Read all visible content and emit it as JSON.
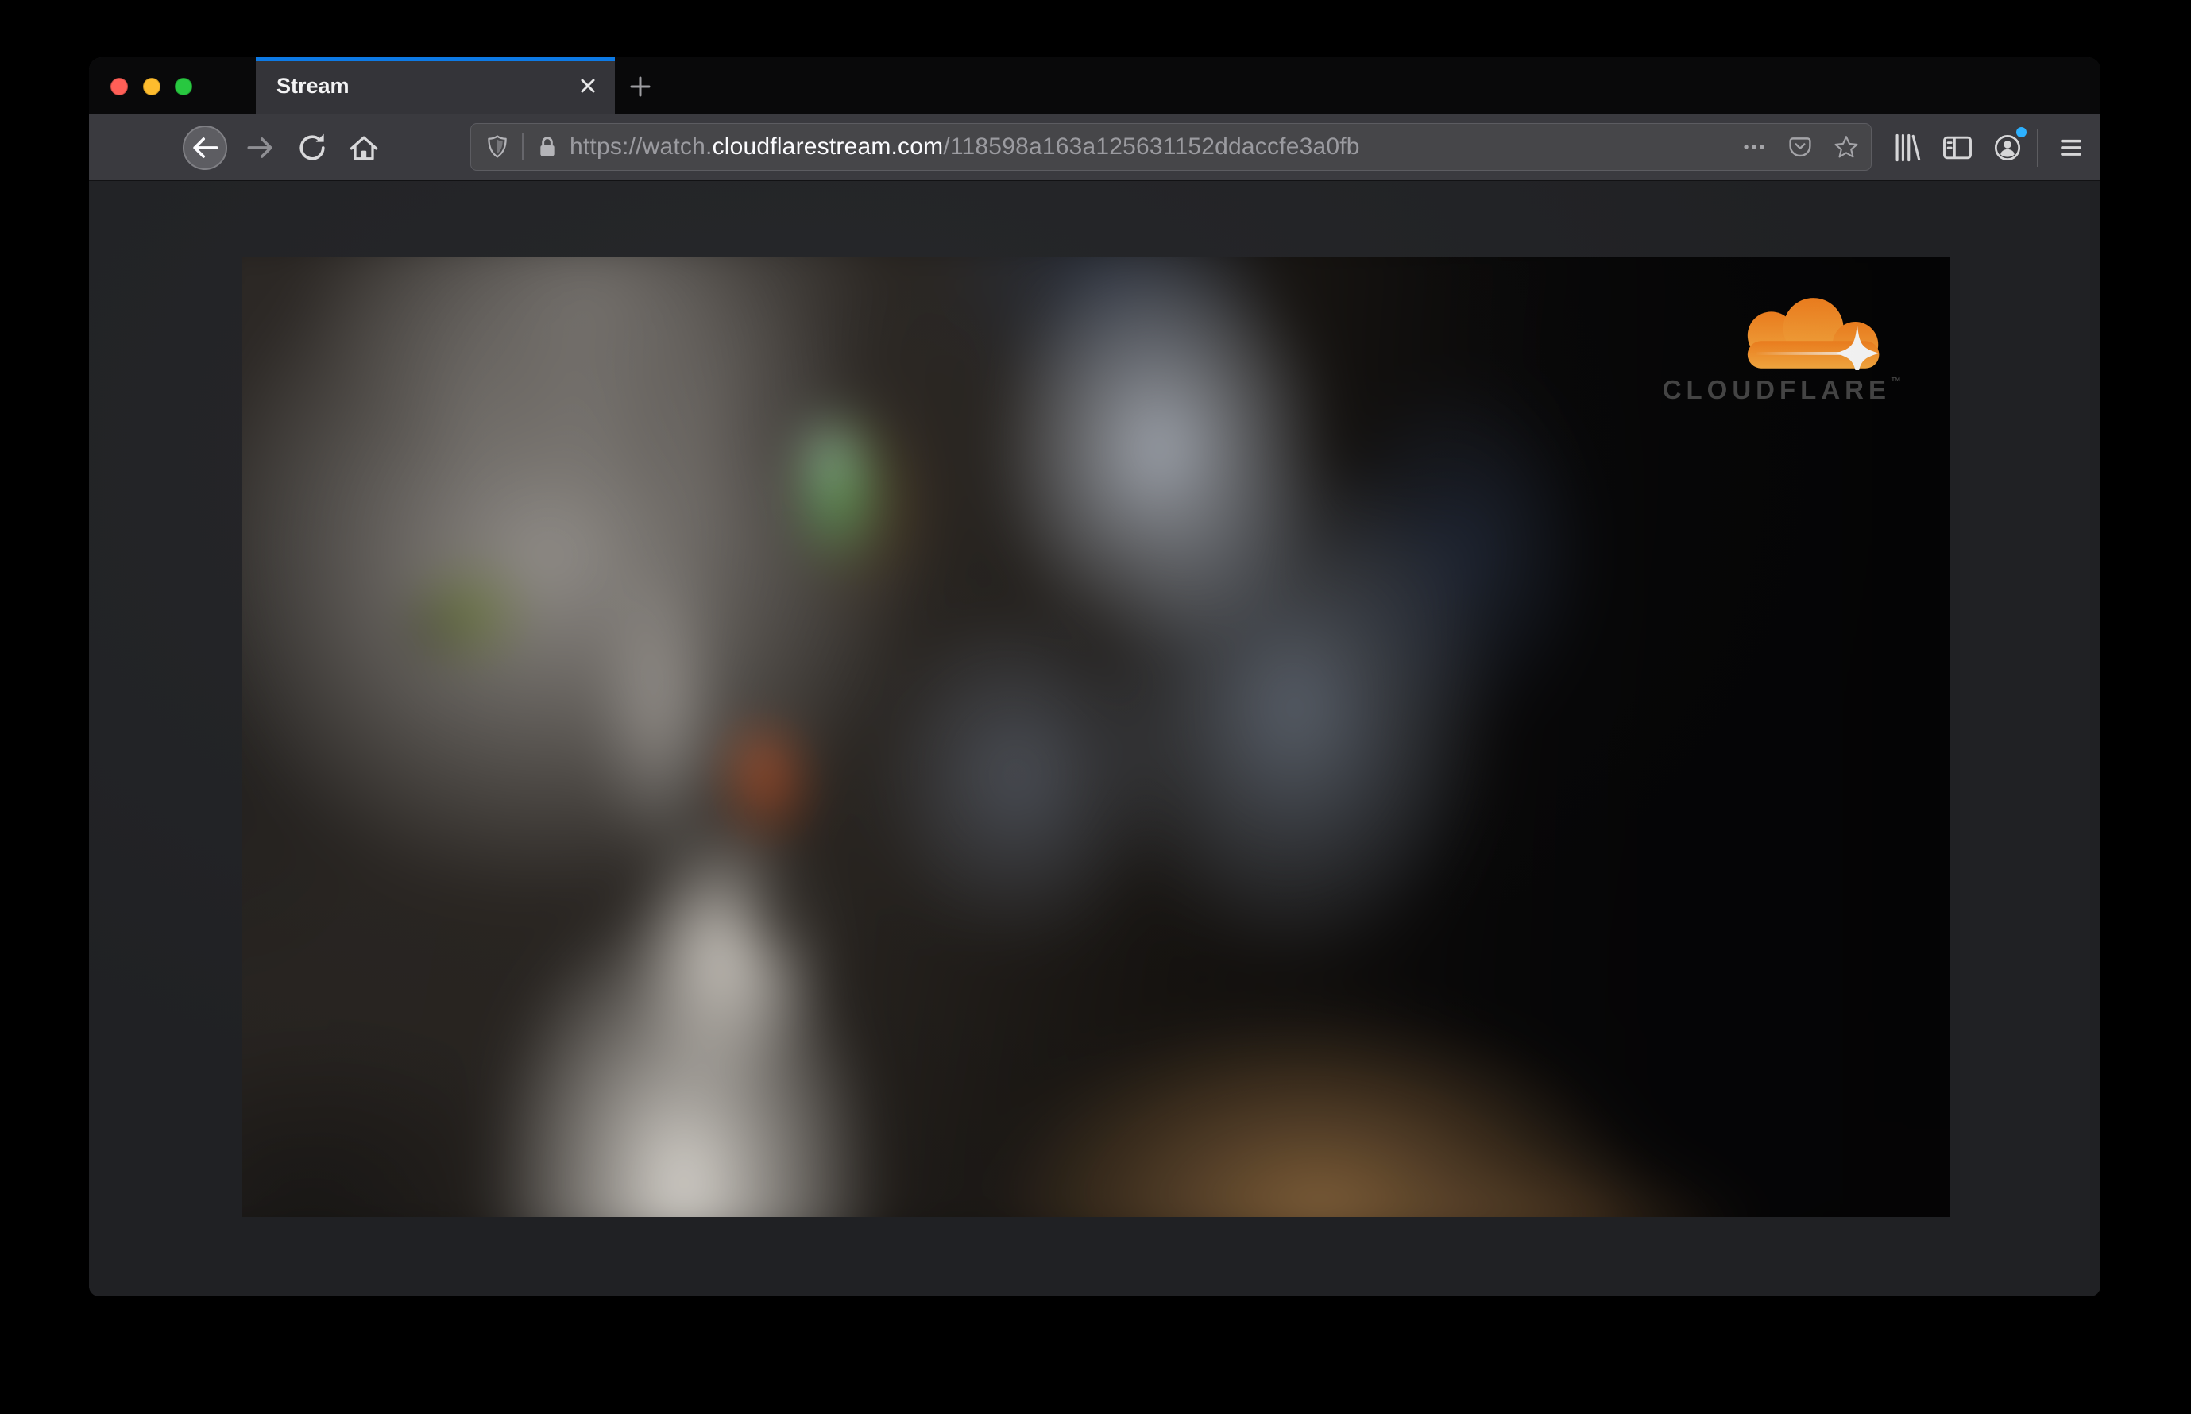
{
  "window": {
    "controls": [
      {
        "name": "close",
        "color": "#ff5f57"
      },
      {
        "name": "minimize",
        "color": "#febc2e"
      },
      {
        "name": "zoom",
        "color": "#28c840"
      }
    ]
  },
  "tabs": {
    "active": {
      "title": "Stream"
    },
    "accent_color": "#0d7ae5"
  },
  "navbar": {
    "url": {
      "prefix": "https://watch.",
      "domain": "cloudflarestream.com",
      "path": "/118598a163a125631152ddaccfe3a0fb"
    },
    "icons": {
      "back": "left-arrow-circle",
      "forward": "right-arrow",
      "reload": "refresh-arrow",
      "home": "house",
      "tracking_protection": "shield",
      "connection_security": "lock",
      "page_actions": "ellipsis",
      "pocket": "pocket-pouch-chevron",
      "bookmark": "star-outline",
      "library": "books",
      "sidebars": "split-panel",
      "account": "person-circle",
      "account_badge_color": "#2db1ff",
      "menu": "hamburger",
      "close_tab": "x",
      "new_tab": "plus"
    }
  },
  "player": {
    "watermark": {
      "brand": "CLOUDFLARE",
      "trademark": "™",
      "cloud_color": "#f6821f",
      "cloud_color_light": "#fbad41",
      "text_color": "#474747"
    },
    "scene": "Blurred close-up video frame of a gray tabby cat with green eyes, white chest, orange nose; out-of-focus blue-gray background left of a dark right side"
  }
}
